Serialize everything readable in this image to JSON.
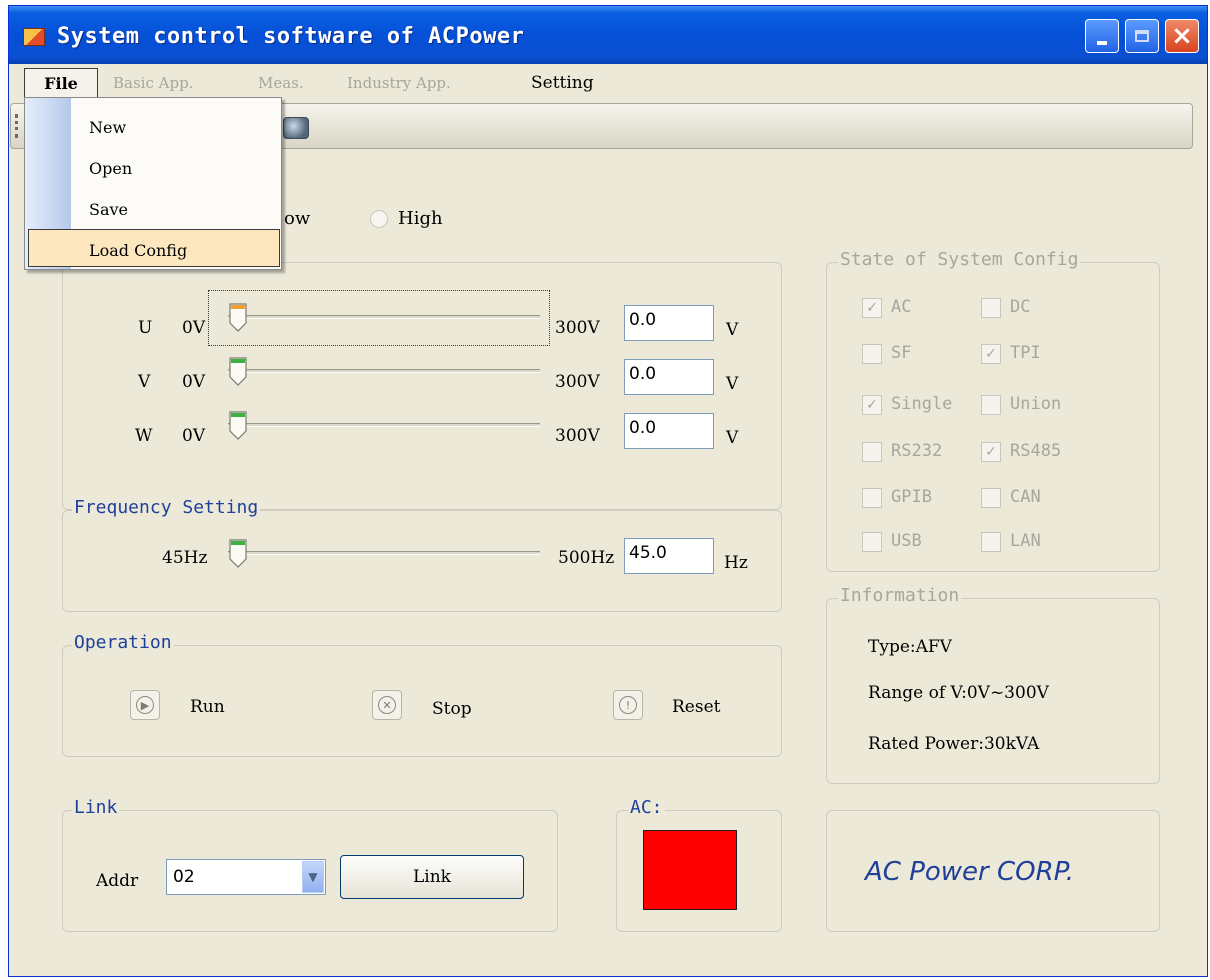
{
  "window": {
    "title": "System control software of ACPower"
  },
  "menu": {
    "file": "File",
    "basic_app": "Basic App.",
    "meas": "Meas.",
    "industry_app": "Industry App.",
    "setting": "Setting"
  },
  "file_menu": {
    "items": [
      "New",
      "Open",
      "Save",
      "Load Config"
    ],
    "highlighted": "Load Config"
  },
  "range_mode": {
    "low_label_partial": "ow",
    "high_label": "High"
  },
  "voltage": {
    "rows": [
      {
        "phase": "U",
        "min": "0V",
        "max": "300V",
        "value": "0.0",
        "unit": "V",
        "level": 0
      },
      {
        "phase": "V",
        "min": "0V",
        "max": "300V",
        "value": "0.0",
        "unit": "V",
        "level": 0
      },
      {
        "phase": "W",
        "min": "0V",
        "max": "300V",
        "value": "0.0",
        "unit": "V",
        "level": 0
      }
    ]
  },
  "frequency": {
    "title": "Frequency Setting",
    "min": "45Hz",
    "max": "500Hz",
    "value": "45.0",
    "unit": "Hz",
    "level": 0
  },
  "operation": {
    "title": "Operation",
    "run": "Run",
    "stop": "Stop",
    "reset": "Reset"
  },
  "link": {
    "title": "Link",
    "addr_label": "Addr",
    "addr_value": "02",
    "button": "Link"
  },
  "ac": {
    "title": "AC:",
    "indicator_color": "#ff0000"
  },
  "system_config": {
    "title": "State of System Config",
    "items": [
      {
        "label": "AC",
        "checked": true
      },
      {
        "label": "DC",
        "checked": false
      },
      {
        "label": "SF",
        "checked": false
      },
      {
        "label": "TPI",
        "checked": true
      },
      {
        "label": "Single",
        "checked": true
      },
      {
        "label": "Union",
        "checked": false
      },
      {
        "label": "RS232",
        "checked": false
      },
      {
        "label": "RS485",
        "checked": true
      },
      {
        "label": "GPIB",
        "checked": false
      },
      {
        "label": "CAN",
        "checked": false
      },
      {
        "label": "USB",
        "checked": false
      },
      {
        "label": "LAN",
        "checked": false
      }
    ]
  },
  "information": {
    "title": "Information",
    "type": "Type:AFV",
    "range": "Range of V:0V~300V",
    "rated_power": "Rated Power:30kVA"
  },
  "brand": {
    "text": "AC Power CORP."
  },
  "colors": {
    "title_bar": "#0550d8",
    "group_title": "#1f3f9b",
    "ac_indicator": "#ff0000"
  }
}
